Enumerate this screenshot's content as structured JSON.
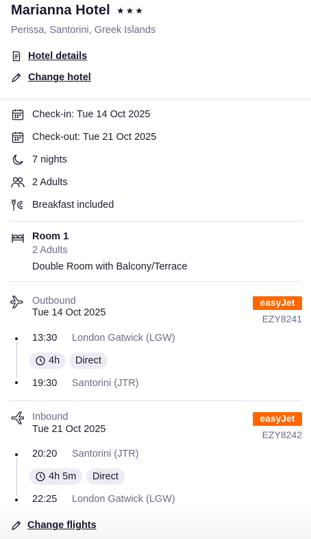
{
  "hotel": {
    "name": "Marianna Hotel",
    "stars_text": "★★★",
    "rating_stars": 3,
    "location": "Perissa, Santorini, Greek Islands"
  },
  "links": {
    "hotel_details": "Hotel details",
    "change_hotel": "Change hotel",
    "change_flights": "Change flights"
  },
  "stay": {
    "check_in": "Check-in: Tue 14 Oct 2025",
    "check_out": "Check-out: Tue 21 Oct 2025",
    "nights": "7 nights",
    "guests": "2 Adults",
    "board": "Breakfast included"
  },
  "room": {
    "title": "Room 1",
    "occupancy": "2 Adults",
    "type": "Double Room with Balcony/Terrace"
  },
  "outbound": {
    "label": "Outbound",
    "date": "Tue 14 Oct 2025",
    "airline": "easyJet",
    "flight_number": "EZY8241",
    "depart_time": "13:30",
    "depart_airport": "London Gatwick (LGW)",
    "duration": "4h",
    "stops": "Direct",
    "arrive_time": "19:30",
    "arrive_airport": "Santorini (JTR)"
  },
  "inbound": {
    "label": "Inbound",
    "date": "Tue 21 Oct 2025",
    "airline": "easyJet",
    "flight_number": "EZY8242",
    "depart_time": "20:20",
    "depart_airport": "Santorini (JTR)",
    "duration": "4h 5m",
    "stops": "Direct",
    "arrive_time": "22:25",
    "arrive_airport": "London Gatwick (LGW)"
  },
  "colors": {
    "airline_brand": "#ff6600",
    "text_primary": "#1a1a2e",
    "text_secondary": "#6b6b8a",
    "pill_bg": "#ececf4"
  }
}
